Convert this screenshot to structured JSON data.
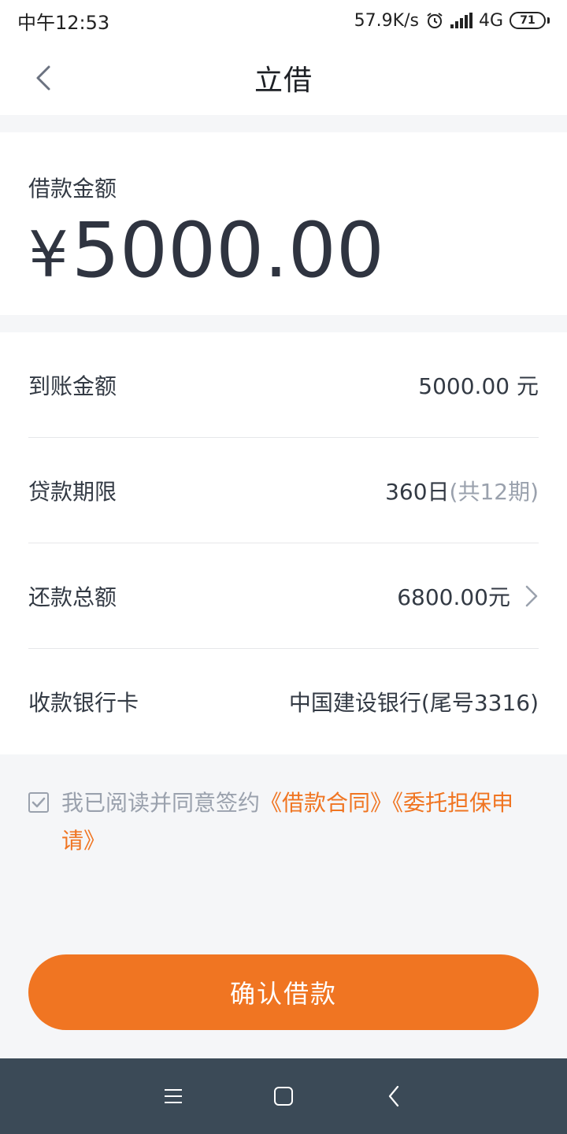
{
  "status_bar": {
    "time": "中午12:53",
    "net_speed": "57.9K/s",
    "network": "4G",
    "battery": "71",
    "icons": [
      "alarm-icon",
      "signal-icon",
      "battery-icon"
    ]
  },
  "header": {
    "title": "立借",
    "back_icon": "chevron-left-icon"
  },
  "amount": {
    "label": "借款金额",
    "currency": "¥",
    "value": "5000.00"
  },
  "details": {
    "items": [
      {
        "label": "到账金额",
        "value": "5000.00 元",
        "extra": ""
      },
      {
        "label": "贷款期限",
        "value": "360日",
        "extra": "(共12期)"
      },
      {
        "label": "还款总额",
        "value": "6800.00元",
        "extra": ""
      },
      {
        "label": "收款银行卡",
        "value": "中国建设银行(尾号3316)",
        "extra": ""
      }
    ]
  },
  "agreement": {
    "checked": true,
    "text": "我已阅读并同意签约",
    "link1": "《借款合同》",
    "link2": "《委托担保申请》"
  },
  "confirm": {
    "label": "确认借款"
  },
  "nav_bar": {
    "icons": [
      "menu-icon",
      "home-icon",
      "back-icon"
    ]
  },
  "colors": {
    "accent": "#f07522",
    "text": "#333a44",
    "muted": "#9aa1ad",
    "nav_bg": "#3b4a57",
    "page_bg": "#f5f6f8"
  }
}
